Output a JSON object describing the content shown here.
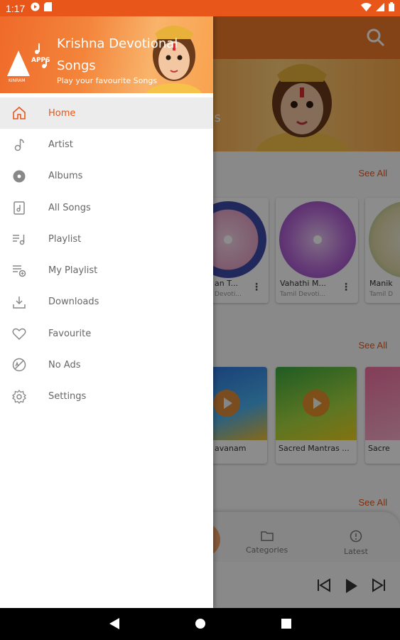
{
  "status_bar": {
    "time": "1:17",
    "bg_color": "#e8561a"
  },
  "drawer": {
    "app_title": "Krishna Devotional Songs",
    "subtitle": "Play your favourite Songs",
    "logo_text": "APPS",
    "logo_brand": "KINRAM",
    "menu": [
      {
        "label": "Home",
        "icon": "home-icon",
        "active": true
      },
      {
        "label": "Artist",
        "icon": "artist-icon"
      },
      {
        "label": "Albums",
        "icon": "albums-icon"
      },
      {
        "label": "All Songs",
        "icon": "all-songs-icon"
      },
      {
        "label": "Playlist",
        "icon": "playlist-icon"
      },
      {
        "label": "My Playlist",
        "icon": "my-playlist-icon"
      },
      {
        "label": "Downloads",
        "icon": "downloads-icon"
      },
      {
        "label": "Favourite",
        "icon": "favourite-icon"
      },
      {
        "label": "No Ads",
        "icon": "no-ads-icon"
      },
      {
        "label": "Settings",
        "icon": "settings-icon"
      }
    ]
  },
  "background": {
    "banner_text": "gs",
    "see_all_1": "See All",
    "see_all_2": "See All",
    "see_all_3": "See All",
    "albums": [
      {
        "title": "an T...",
        "sub": "Devoti..."
      },
      {
        "title": "Vahathi M...",
        "sub": "Tamil Devoti..."
      },
      {
        "title": "Manik",
        "sub": "Tamil D"
      }
    ],
    "playlists": [
      {
        "title": "avanam"
      },
      {
        "title": "Sacred Mantras ..."
      },
      {
        "title": "Sacre"
      }
    ],
    "nav_categories": "Categories",
    "nav_latest": "Latest"
  },
  "colors": {
    "accent": "#e8561a",
    "header_orange": "#ef7a2a"
  }
}
